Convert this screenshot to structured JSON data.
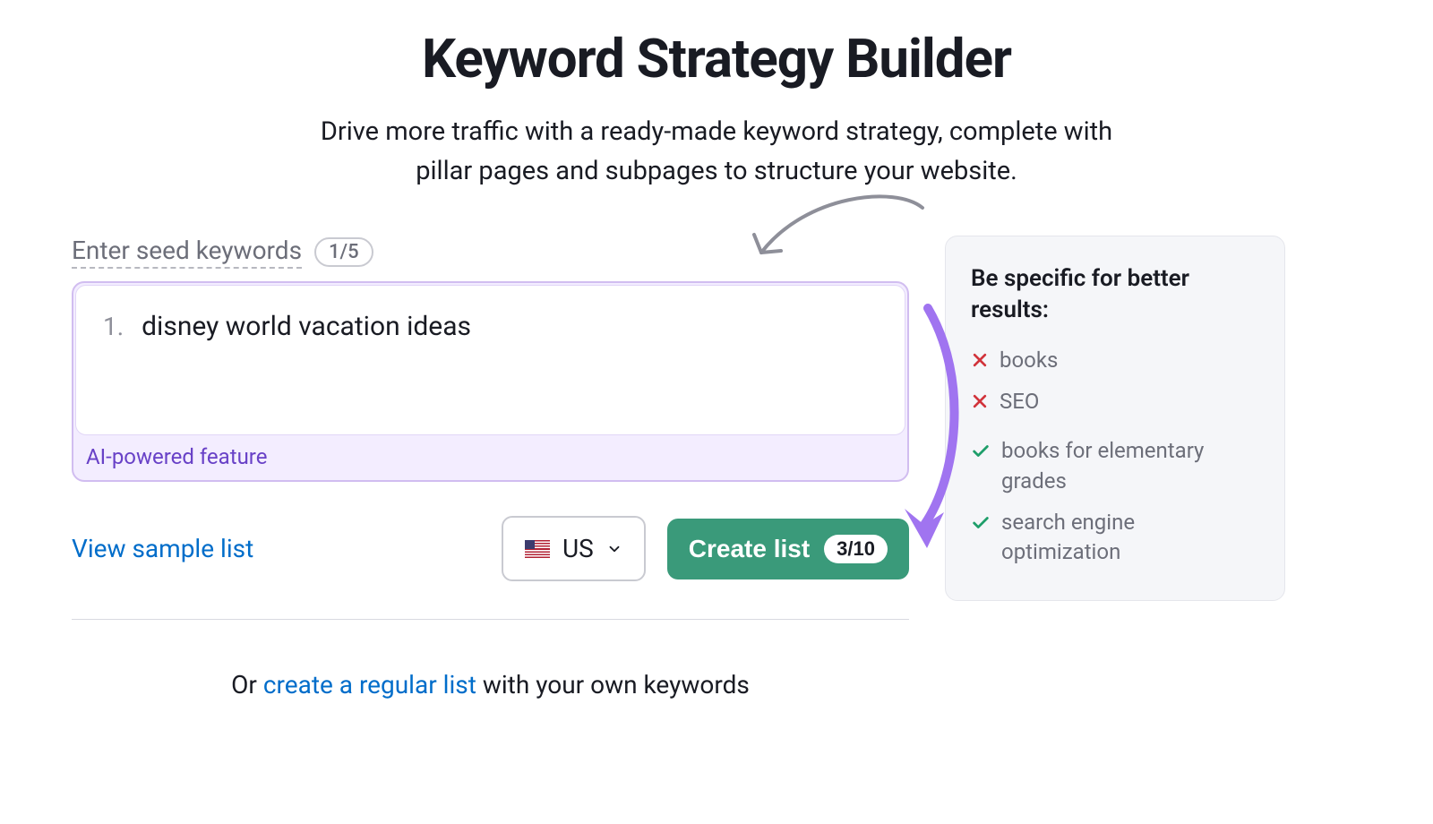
{
  "header": {
    "title": "Keyword Strategy Builder",
    "subtitle": "Drive more traffic with a ready-made keyword strategy, complete with pillar pages and subpages to structure your website."
  },
  "form": {
    "seed_label": "Enter seed keywords",
    "count_badge": "1/5",
    "keyword_number": "1.",
    "keyword_value": "disney world vacation ideas",
    "ai_label": "AI-powered feature"
  },
  "actions": {
    "sample_link": "View sample list",
    "country_code": "US",
    "create_label": "Create list",
    "create_badge": "3/10"
  },
  "or_row": {
    "prefix": "Or ",
    "link": "create a regular list",
    "suffix": " with your own keywords"
  },
  "tips": {
    "title": "Be specific for better results:",
    "bad": [
      "books",
      "SEO"
    ],
    "good": [
      "books for elementary grades",
      "search engine optimization"
    ]
  },
  "colors": {
    "accent_purple": "#6841c7",
    "accent_green": "#3a9a7a",
    "link_blue": "#006dca",
    "bad_red": "#d1333b",
    "good_green": "#1e9e6a"
  }
}
